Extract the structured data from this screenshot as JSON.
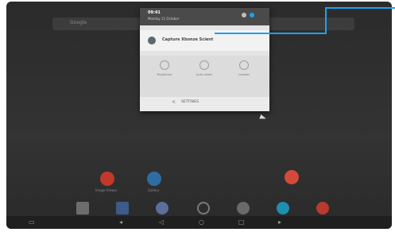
{
  "search": {
    "placeholder": "Google"
  },
  "shade": {
    "time": "09:41",
    "date": "Monday 11 October",
    "notification_title": "Capture Xbonze Scient",
    "tiles": [
      {
        "label": "Brightness",
        "icon": "brightness-icon"
      },
      {
        "label": "Auto-rotate",
        "icon": "rotate-icon"
      },
      {
        "label": "Location",
        "icon": "location-icon"
      }
    ],
    "settings_label": "SETTINGS"
  },
  "home": {
    "apps": [
      {
        "label": "Image Viewer",
        "color": "#c0392b"
      },
      {
        "label": "Gallery",
        "color": "#2e6da4"
      },
      {
        "label": "",
        "color": "#d44a3a"
      }
    ],
    "dock": [
      "#6d6d6d",
      "#3d5a8a",
      "#5b6e9c",
      "#4c4c4c",
      "#6a6a6a",
      "#1e8fb0",
      "#b83a2e"
    ]
  },
  "colors": {
    "accent_line": "#1da1f2",
    "shade_bg": "#e4e4e4"
  }
}
